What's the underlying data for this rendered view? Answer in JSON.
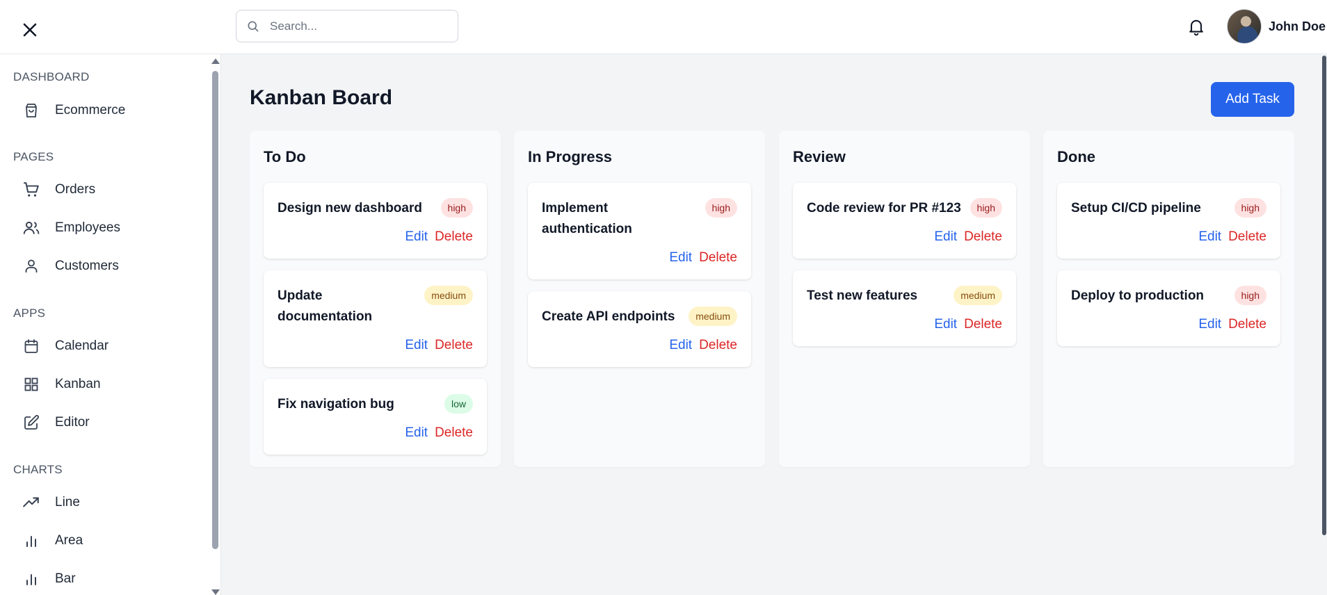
{
  "header": {
    "search_placeholder": "Search...",
    "user_name": "John Doe"
  },
  "sidebar": {
    "sections": [
      {
        "title": "DASHBOARD",
        "items": [
          {
            "label": "Ecommerce",
            "icon": "shopping-bag-icon"
          }
        ]
      },
      {
        "title": "PAGES",
        "items": [
          {
            "label": "Orders",
            "icon": "shopping-cart-icon"
          },
          {
            "label": "Employees",
            "icon": "users-icon"
          },
          {
            "label": "Customers",
            "icon": "user-icon"
          }
        ]
      },
      {
        "title": "APPS",
        "items": [
          {
            "label": "Calendar",
            "icon": "calendar-icon"
          },
          {
            "label": "Kanban",
            "icon": "grid-icon"
          },
          {
            "label": "Editor",
            "icon": "edit-icon"
          }
        ]
      },
      {
        "title": "CHARTS",
        "items": [
          {
            "label": "Line",
            "icon": "trending-up-icon"
          },
          {
            "label": "Area",
            "icon": "bar-chart-icon"
          },
          {
            "label": "Bar",
            "icon": "bar-chart-icon"
          }
        ]
      }
    ]
  },
  "main": {
    "title": "Kanban Board",
    "add_task_label": "Add Task",
    "edit_label": "Edit",
    "delete_label": "Delete",
    "columns": [
      {
        "title": "To Do",
        "cards": [
          {
            "title": "Design new dashboard",
            "priority": "high"
          },
          {
            "title": "Update documentation",
            "priority": "medium"
          },
          {
            "title": "Fix navigation bug",
            "priority": "low"
          }
        ]
      },
      {
        "title": "In Progress",
        "cards": [
          {
            "title": "Implement authentication",
            "priority": "high"
          },
          {
            "title": "Create API endpoints",
            "priority": "medium"
          }
        ]
      },
      {
        "title": "Review",
        "cards": [
          {
            "title": "Code review for PR #123",
            "priority": "high"
          },
          {
            "title": "Test new features",
            "priority": "medium"
          }
        ]
      },
      {
        "title": "Done",
        "cards": [
          {
            "title": "Setup CI/CD pipeline",
            "priority": "high"
          },
          {
            "title": "Deploy to production",
            "priority": "high"
          }
        ]
      }
    ]
  },
  "colors": {
    "primary": "#2563eb",
    "danger": "#dc2626",
    "high_bg": "#fee2e2",
    "medium_bg": "#fef3c7",
    "low_bg": "#dcfce7"
  }
}
